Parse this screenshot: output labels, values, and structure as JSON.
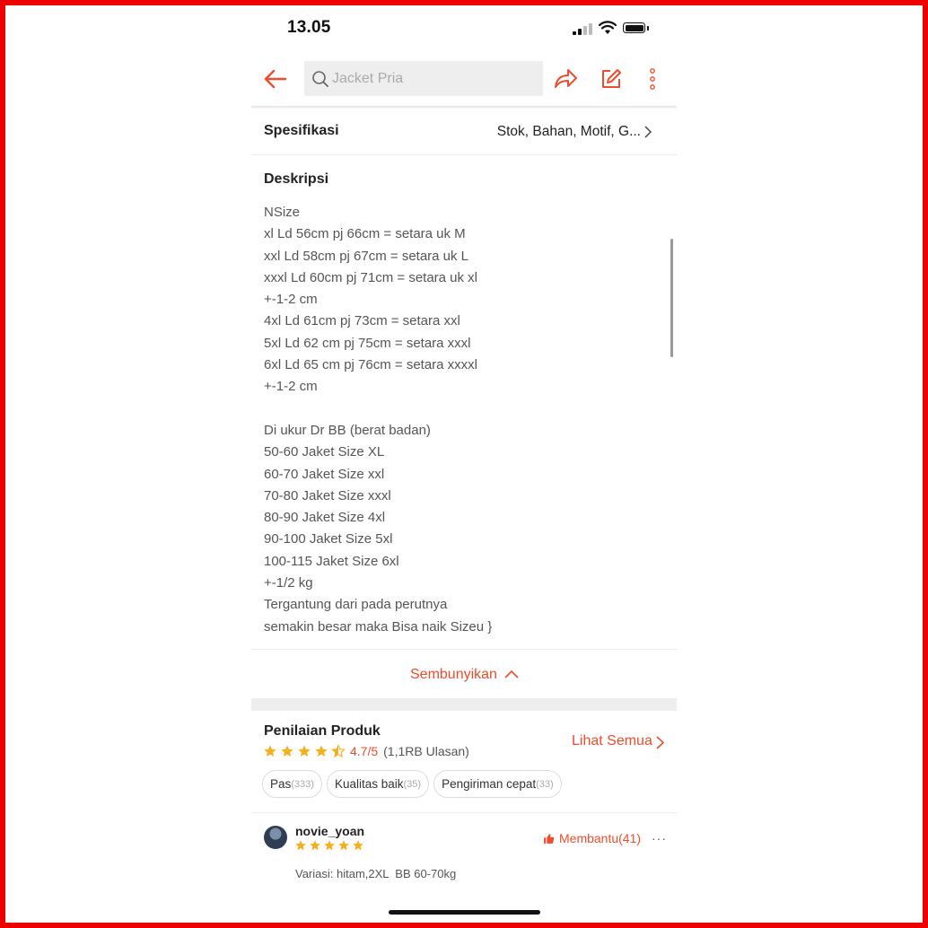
{
  "status_bar": {
    "time": "13.05"
  },
  "top_nav": {
    "search_placeholder": "Jacket Pria"
  },
  "specification": {
    "label": "Spesifikasi",
    "value": "Stok, Bahan, Motif, G..."
  },
  "description": {
    "title": "Deskripsi",
    "lines": [
      "NSize",
      "xl Ld 56cm pj 66cm = setara uk M",
      "xxl Ld 58cm pj 67cm = setara uk L",
      "xxxl Ld 60cm pj 71cm = setara uk xl",
      "+-1-2 cm",
      "4xl Ld 61cm pj 73cm = setara xxl",
      "5xl Ld 62 cm pj 75cm = setara xxxl",
      "6xl Ld 65 cm pj 76cm = setara xxxxl",
      "+-1-2 cm",
      "",
      "Di ukur Dr BB (berat badan)",
      "50-60 Jaket Size XL",
      "60-70 Jaket Size xxl",
      "70-80 Jaket Size xxxl",
      "80-90 Jaket Size 4xl",
      "90-100 Jaket Size 5xl",
      "100-115 Jaket Size 6xl",
      "+-1/2 kg",
      "Tergantung dari pada perutnya",
      "semakin besar maka Bisa naik Sizeu }"
    ],
    "hide_label": "Sembunyikan"
  },
  "reviews": {
    "title": "Penilaian Produk",
    "stars_shown": 4.5,
    "rating": "4.7/5",
    "rating_count": "(1,1RB Ulasan)",
    "see_all_label": "Lihat Semua",
    "chips": [
      {
        "label": "Pas",
        "count": "(333)"
      },
      {
        "label": "Kualitas baik",
        "count": "(35)"
      },
      {
        "label": "Pengiriman cepat",
        "count": "(33)"
      }
    ],
    "items": [
      {
        "username": "novie_yoan",
        "stars": 5,
        "helpful_label": "Membantu(41)",
        "more": "···",
        "variation": "Variasi: hitam,2XL  BB 60-70kg"
      }
    ]
  },
  "colors": {
    "accent": "#ee4d2d",
    "star": "#f6b01e",
    "frame": "#ee0000"
  }
}
